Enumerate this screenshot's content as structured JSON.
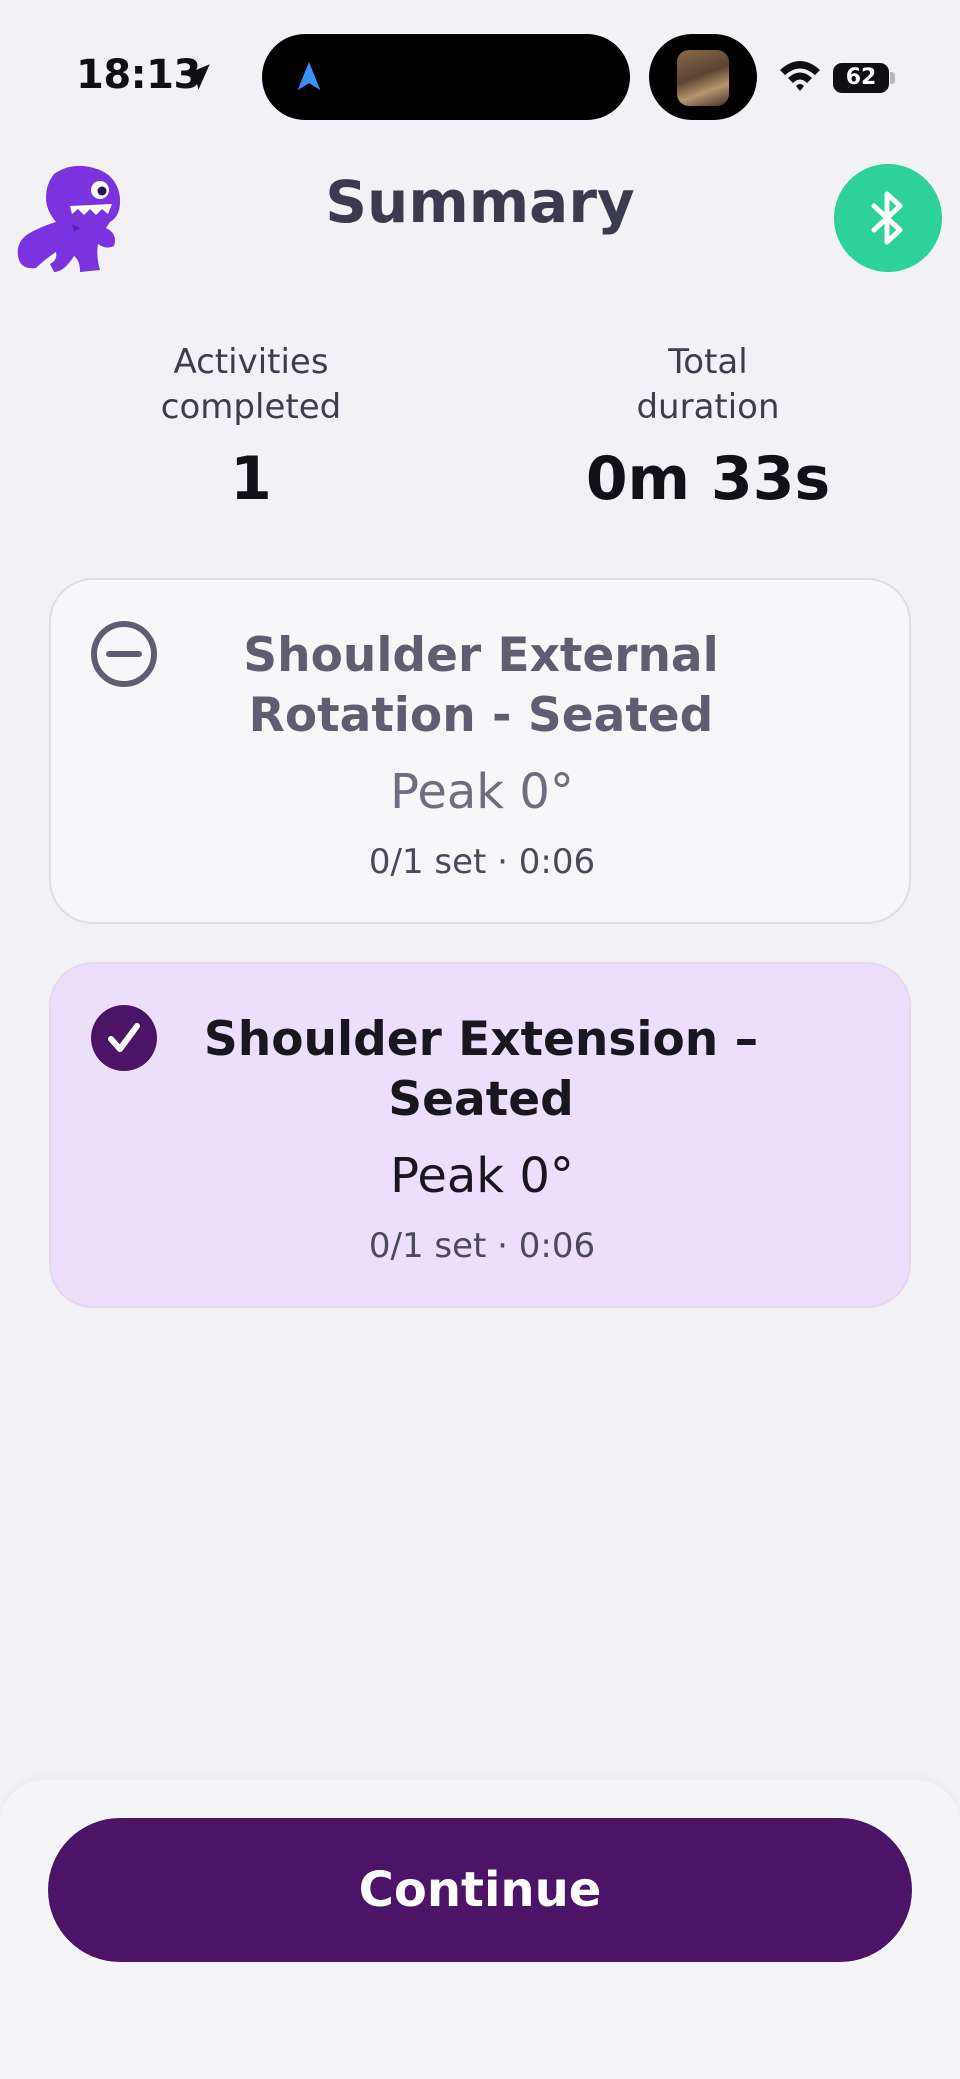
{
  "status_bar": {
    "time": "18:13",
    "battery": "62",
    "icons": [
      "location-arrow-icon",
      "navigation-icon",
      "media-thumbnail",
      "wifi-icon",
      "battery-icon"
    ]
  },
  "header": {
    "title": "Summary",
    "mascot_icon": "dinosaur-mascot",
    "bluetooth_icon": "bluetooth-icon",
    "bluetooth_color": "#2ed19a"
  },
  "stats": {
    "activities_label": "Activities\ncompleted",
    "activities_value": "1",
    "duration_label": "Total\nduration",
    "duration_value": "0m 33s"
  },
  "activities": [
    {
      "title": "Shoulder External Rotation - Seated",
      "peak": "Peak 0°",
      "meta": "0/1 set · 0:06",
      "status_icon": "minus-circle-icon",
      "completed": false
    },
    {
      "title": "Shoulder Extension – Seated",
      "peak": "Peak 0°",
      "meta": "0/1 set · 0:06",
      "status_icon": "check-circle-icon",
      "completed": true
    }
  ],
  "footer": {
    "continue_label": "Continue",
    "accent_color": "#4b1466"
  },
  "colors": {
    "background": "#f1f1f6",
    "completed_card": "#ebdffc",
    "mascot": "#7b33e0"
  }
}
